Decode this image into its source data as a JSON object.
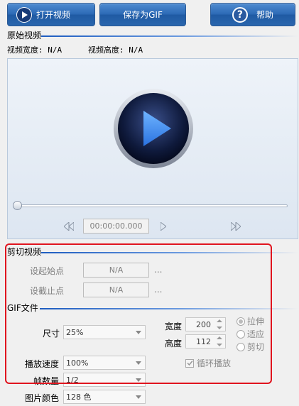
{
  "toolbar": {
    "open_video": "打开视频",
    "save_gif": "保存为GIF",
    "help": "帮助",
    "help_icon_text": "?"
  },
  "original_video": {
    "title": "原始视频",
    "width_label": "视频宽度: N/A",
    "height_label": "视频高度: N/A"
  },
  "player": {
    "timecode": "00:00:00.000"
  },
  "cut": {
    "title": "剪切视频",
    "start_label": "设起始点",
    "start_value": "N/A",
    "end_label": "设截止点",
    "end_value": "N/A",
    "ellipsis": "..."
  },
  "gif": {
    "title": "GIF文件",
    "size_label": "尺寸",
    "size_value": "25%",
    "width_label": "宽度",
    "width_value": "200",
    "height_label": "高度",
    "height_value": "112",
    "fit_options": [
      "拉伸",
      "适应",
      "剪切"
    ],
    "speed_label": "播放速度",
    "speed_value": "100%",
    "loop_label": "循环播放",
    "frames_label": "帧数量",
    "frames_value": "1/2",
    "colors_label": "图片颜色",
    "colors_value": "128 色"
  },
  "colors": {
    "accent": "#1d5cc0",
    "highlight_frame": "#e0141e"
  }
}
